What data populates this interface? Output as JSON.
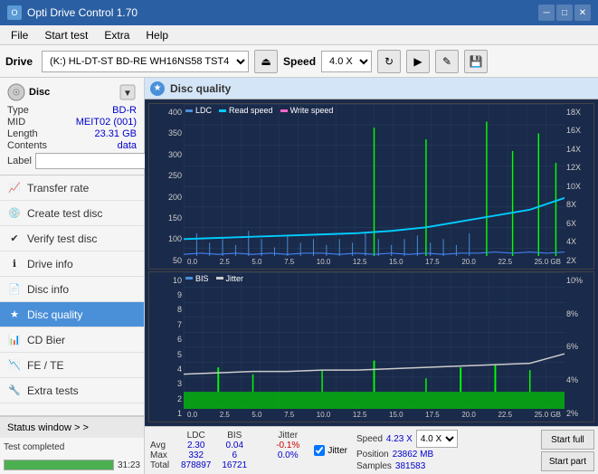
{
  "titleBar": {
    "title": "Opti Drive Control 1.70",
    "minimize": "─",
    "maximize": "□",
    "close": "✕"
  },
  "menuBar": {
    "items": [
      "File",
      "Start test",
      "Extra",
      "Help"
    ]
  },
  "driveToolbar": {
    "driveLabel": "Drive",
    "driveValue": "(K:) HL-DT-ST BD-RE WH16NS58 TST4",
    "speedLabel": "Speed",
    "speedValue": "4.0 X"
  },
  "disc": {
    "title": "Disc",
    "typeKey": "Type",
    "typeVal": "BD-R",
    "midKey": "MID",
    "midVal": "MEIT02 (001)",
    "lengthKey": "Length",
    "lengthVal": "23.31 GB",
    "contentsKey": "Contents",
    "contentsVal": "data",
    "labelKey": "Label",
    "labelVal": ""
  },
  "navItems": [
    {
      "id": "transfer-rate",
      "label": "Transfer rate",
      "icon": "📈"
    },
    {
      "id": "create-test-disc",
      "label": "Create test disc",
      "icon": "💿"
    },
    {
      "id": "verify-test-disc",
      "label": "Verify test disc",
      "icon": "✔"
    },
    {
      "id": "drive-info",
      "label": "Drive info",
      "icon": "ℹ"
    },
    {
      "id": "disc-info",
      "label": "Disc info",
      "icon": "📄"
    },
    {
      "id": "disc-quality",
      "label": "Disc quality",
      "icon": "★",
      "active": true
    },
    {
      "id": "cd-bier",
      "label": "CD Bier",
      "icon": "📊"
    },
    {
      "id": "fe-te",
      "label": "FE / TE",
      "icon": "📉"
    },
    {
      "id": "extra-tests",
      "label": "Extra tests",
      "icon": "🔧"
    }
  ],
  "discQuality": {
    "title": "Disc quality",
    "legend1": {
      "ldc": "LDC",
      "read": "Read speed",
      "write": "Write speed"
    },
    "legend2": {
      "bis": "BIS",
      "jitter": "Jitter"
    },
    "chart1YLabels": [
      "400",
      "350",
      "300",
      "250",
      "200",
      "150",
      "100",
      "50"
    ],
    "chart1YRightLabels": [
      "18X",
      "16X",
      "14X",
      "12X",
      "10X",
      "8X",
      "6X",
      "4X",
      "2X"
    ],
    "chart2YLabels": [
      "10",
      "9",
      "8",
      "7",
      "6",
      "5",
      "4",
      "3",
      "2",
      "1"
    ],
    "chart2YRightLabels": [
      "10%",
      "8%",
      "6%",
      "4%",
      "2%"
    ],
    "xLabels": [
      "0.0",
      "2.5",
      "5.0",
      "7.5",
      "10.0",
      "12.5",
      "15.0",
      "17.5",
      "20.0",
      "22.5",
      "25.0 GB"
    ],
    "stats": {
      "headers": [
        "LDC",
        "BIS",
        "",
        "Jitter",
        "Speed",
        ""
      ],
      "avg": {
        "ldc": "2.30",
        "bis": "0.04",
        "jitter": "-0.1%",
        "speed": "4.23 X",
        "speedSel": "4.0 X"
      },
      "max": {
        "ldc": "332",
        "bis": "6",
        "jitter": "0.0%"
      },
      "total": {
        "ldc": "878897",
        "bis": "16721"
      },
      "position": {
        "label": "Position",
        "val": "23862 MB"
      },
      "samples": {
        "label": "Samples",
        "val": "381583"
      }
    },
    "startFull": "Start full",
    "startPart": "Start part"
  },
  "statusBar": {
    "statusWindowLabel": "Status window > >",
    "statusText": "Test completed",
    "progress": 100,
    "time": "31:23"
  }
}
